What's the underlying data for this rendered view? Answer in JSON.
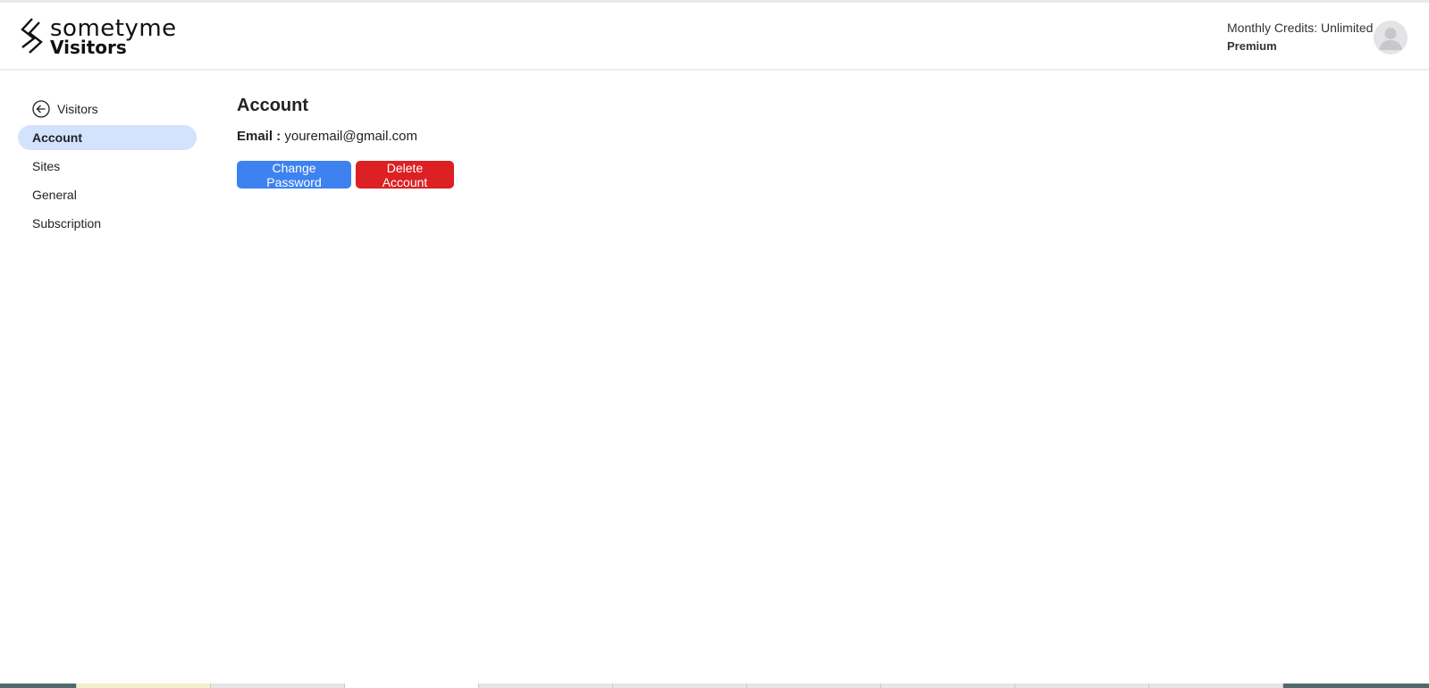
{
  "logo": {
    "top_word": "sometyme",
    "bottom_word": "Visitors"
  },
  "account_status": {
    "credits": "Monthly Credits: Unlimited",
    "plan": "Premium"
  },
  "sidebar": {
    "back_label": "Visitors",
    "items": [
      {
        "label": "Account",
        "active": true
      },
      {
        "label": "Sites",
        "active": false
      },
      {
        "label": "General",
        "active": false
      },
      {
        "label": "Subscription",
        "active": false
      }
    ]
  },
  "main": {
    "title": "Account",
    "email_label": "Email :",
    "email_value": "youremail@gmail.com",
    "change_password_label": "Change Password",
    "delete_account_label": "Delete Account"
  },
  "colors": {
    "accent_blue": "#3d82f0",
    "danger_red": "#dc2023",
    "active_nav_bg": "#d3e3fd"
  },
  "icons": {
    "back": "arrow-left-circle-icon",
    "avatar": "user-avatar-icon",
    "logo": "logo-chevrons-icon"
  }
}
